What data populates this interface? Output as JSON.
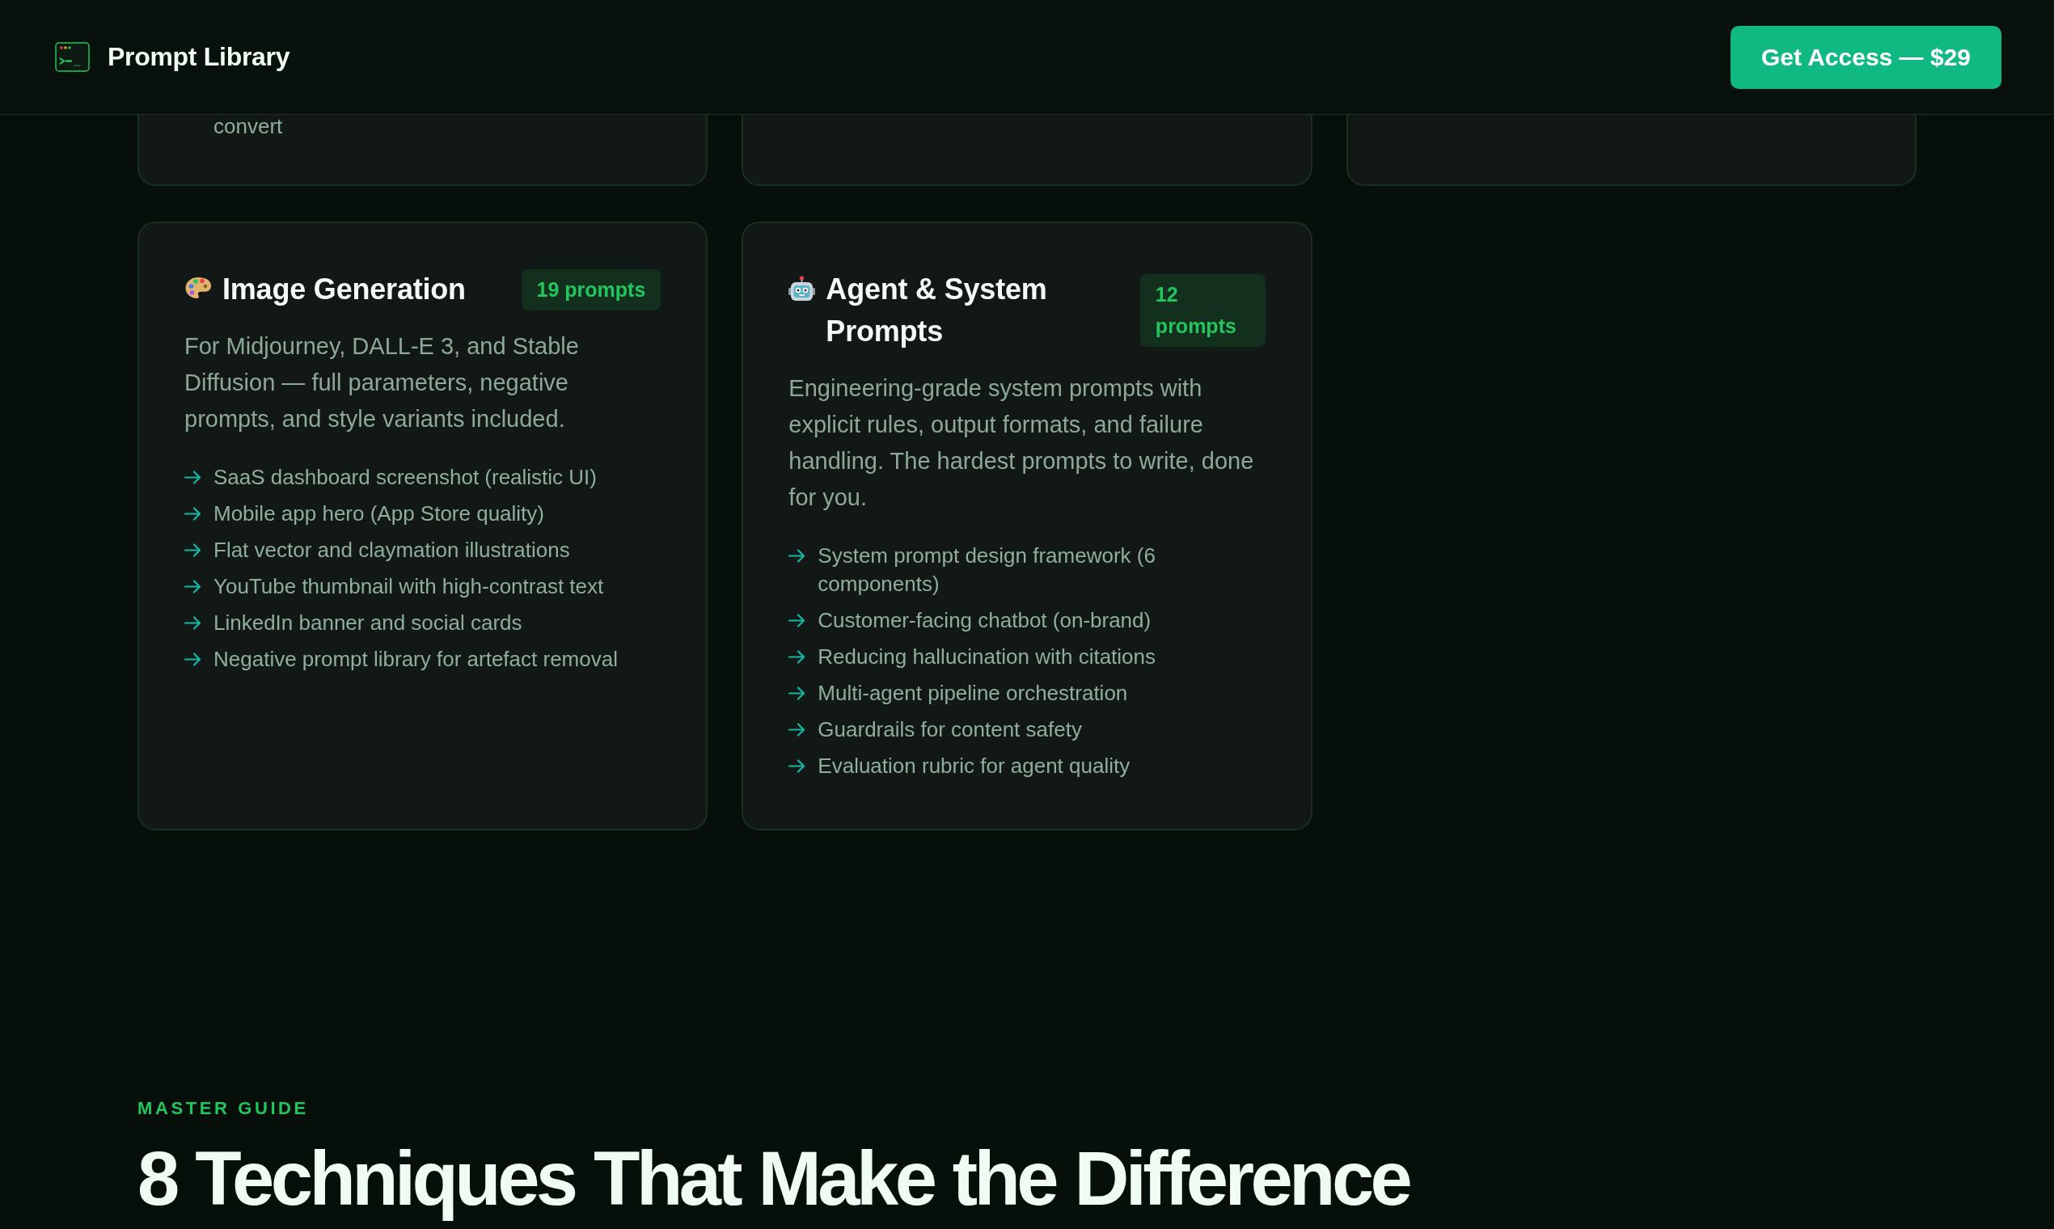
{
  "header": {
    "brand": "Prompt Library",
    "cta_button": "Get Access — $29"
  },
  "partial_cards": [
    {
      "kind": "text",
      "lines": [
        "convert"
      ]
    },
    {
      "kind": "blank"
    },
    {
      "kind": "blank"
    }
  ],
  "categories": [
    {
      "kind": "image",
      "title": "Image Generation",
      "badge": "19 prompts",
      "description": "For Midjourney, DALL-E 3, and Stable Diffusion — full parameters, negative prompts, and style variants included.",
      "items": [
        "SaaS dashboard screenshot (realistic UI)",
        "Mobile app hero (App Store quality)",
        "Flat vector and claymation illustrations",
        "YouTube thumbnail with high-contrast text",
        "LinkedIn banner and social cards",
        "Negative prompt library for artefact removal"
      ]
    },
    {
      "kind": "agent",
      "title": "Agent & System Prompts",
      "badge": "12 prompts",
      "description": "Engineering-grade system prompts with explicit rules, output formats, and failure handling. The hardest prompts to write, done for you.",
      "items": [
        "System prompt design framework (6 components)",
        "Customer-facing chatbot (on-brand)",
        "Reducing hallucination with citations",
        "Multi-agent pipeline orchestration",
        "Guardrails for content safety",
        "Evaluation rubric for agent quality"
      ]
    }
  ],
  "section": {
    "eyebrow": "MASTER GUIDE",
    "heading": "8 Techniques That Make the Difference"
  }
}
